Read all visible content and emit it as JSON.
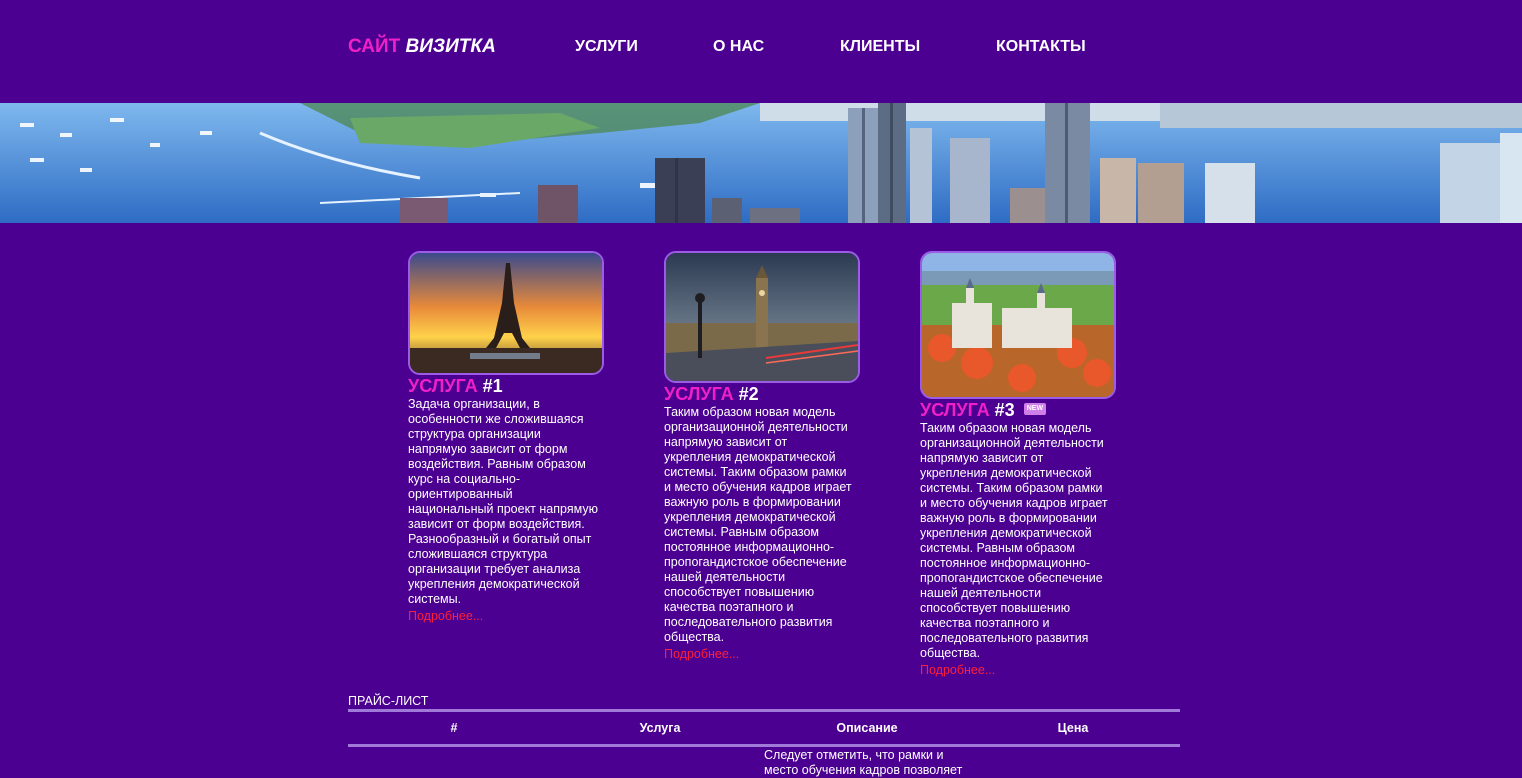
{
  "header": {
    "logo_accent": "САЙТ",
    "logo_rest": "ВИЗИТКА",
    "nav": [
      {
        "label": "УСЛУГИ"
      },
      {
        "label": "О НАС"
      },
      {
        "label": "КЛИЕНТЫ"
      },
      {
        "label": "КОНТАКТЫ"
      }
    ]
  },
  "services": [
    {
      "title_word": "УСЛУГА",
      "title_num": "#1",
      "image": "eiffel-tower-sunset",
      "text": "Задача организации, в особенности же сложившаяся структура организации напрямую зависит от форм воздействия. Равным образом курс на социально-ориентированный национальный проект напрямую зависит от форм воздействия. Разнообразный и богатый опыт сложившаяся структура организации требует анализа укрепления демократической системы.",
      "more": "Подробнее..."
    },
    {
      "title_word": "УСЛУГА",
      "title_num": "#2",
      "image": "big-ben-bridge",
      "text": "Таким образом новая модель организационной деятельности напрямую зависит от укрепления демократической системы. Таким образом рамки и место обучения кадров играет важную роль в формировании укрепления демократической системы. Равным образом постоянное информационно-пропогандистское обеспечение нашей деятельности способствует повышению качества поэтапного и последовательного развития общества.",
      "more": "Подробнее..."
    },
    {
      "title_word": "УСЛУГА",
      "title_num": "#3",
      "badge": "NEW",
      "image": "neuschwanstein-castle-autumn",
      "text": "Таким образом новая модель организационной деятельности напрямую зависит от укрепления демократической системы. Таким образом рамки и место обучения кадров играет важную роль в формировании укрепления демократической системы. Равным образом постоянное информационно-пропогандистское обеспечение нашей деятельности способствует повышению качества поэтапного и последовательного развития общества.",
      "more": "Подробнее..."
    }
  ],
  "price_list": {
    "title": "ПРАЙС-ЛИСТ",
    "columns": [
      "#",
      "Услуга",
      "Описание",
      "Цена"
    ],
    "rows": [
      {
        "description": "Следует отметить, что рамки и место обучения кадров позволяет"
      }
    ]
  },
  "colors": {
    "background": "#4b0092",
    "accent_pink": "#f020c8",
    "link_red": "#ff1f3a",
    "rule": "#a07ad8"
  }
}
